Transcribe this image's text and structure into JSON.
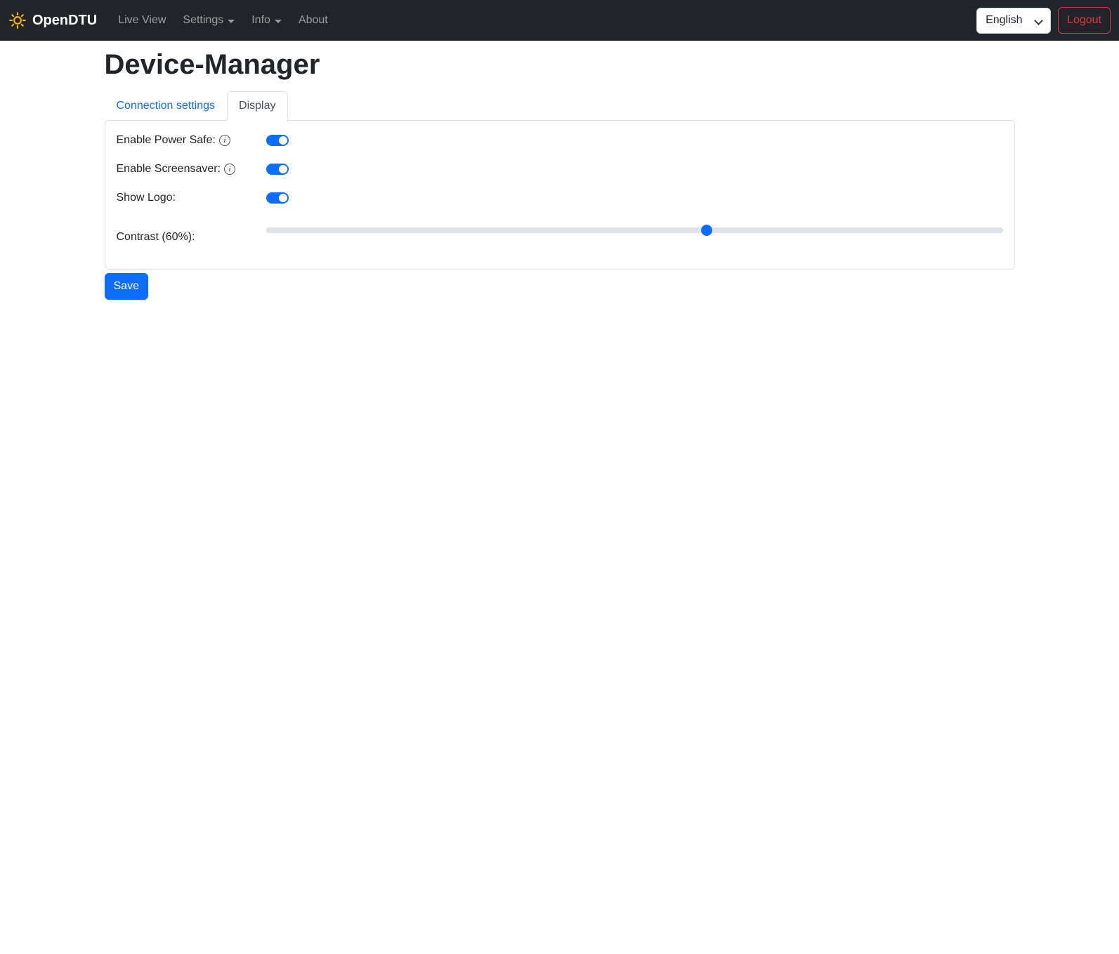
{
  "navbar": {
    "brand": "OpenDTU",
    "links": [
      {
        "label": "Live View",
        "dropdown": false
      },
      {
        "label": "Settings",
        "dropdown": true
      },
      {
        "label": "Info",
        "dropdown": true
      },
      {
        "label": "About",
        "dropdown": false
      }
    ],
    "language": {
      "selected": "English"
    },
    "logout_label": "Logout"
  },
  "page": {
    "title": "Device-Manager"
  },
  "tabs": {
    "connection": "Connection settings",
    "display": "Display"
  },
  "card": {
    "rows": [
      {
        "label": "Enable Power Safe:",
        "type": "switch",
        "checked": true,
        "info": true
      },
      {
        "label": "Enable Screensaver:",
        "type": "switch",
        "checked": true,
        "info": true
      },
      {
        "label": "Show Logo:",
        "type": "switch",
        "checked": true,
        "info": false
      },
      {
        "label": "Contrast (60%):",
        "type": "range",
        "value": 60,
        "min": 0,
        "max": 100
      }
    ]
  },
  "actions": {
    "save": "Save"
  },
  "colors": {
    "primary": "#0d6efd",
    "danger": "#dc3545",
    "navbar_bg": "#212529",
    "border": "#dee2e6",
    "brand_icon": "#f2b305"
  }
}
